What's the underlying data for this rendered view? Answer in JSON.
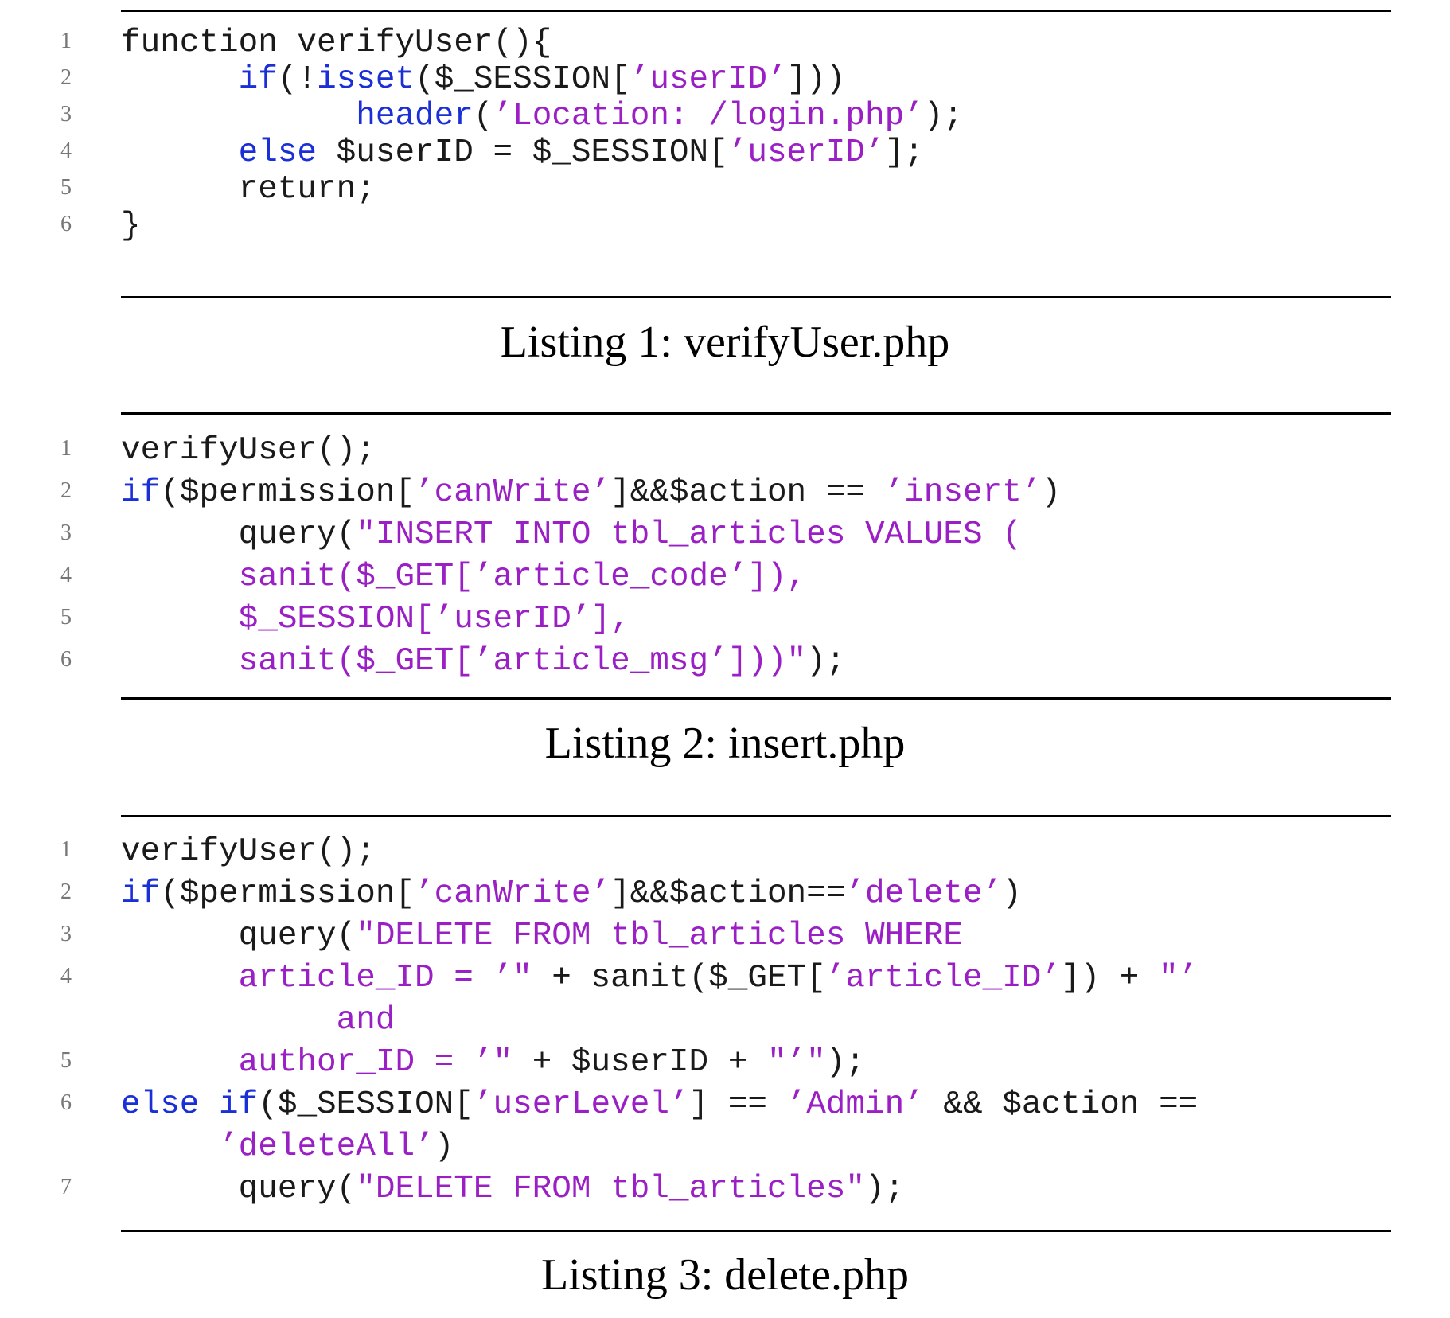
{
  "colors": {
    "keyword": "#1a2fd6",
    "string": "#9a1fc4",
    "plain": "#1a1a1a",
    "line_number": "#777777"
  },
  "listings": [
    {
      "caption": "Listing 1: verifyUser.php",
      "lines": [
        {
          "num": "1",
          "segments": [
            {
              "t": "function verifyUser(){",
              "k": "plain"
            }
          ]
        },
        {
          "num": "2",
          "segments": [
            {
              "t": "      ",
              "k": "plain"
            },
            {
              "t": "if",
              "k": "kw"
            },
            {
              "t": "(!",
              "k": "plain"
            },
            {
              "t": "isset",
              "k": "kw"
            },
            {
              "t": "($_SESSION[",
              "k": "plain"
            },
            {
              "t": "’userID’",
              "k": "str"
            },
            {
              "t": "]))",
              "k": "plain"
            }
          ]
        },
        {
          "num": "3",
          "segments": [
            {
              "t": "            ",
              "k": "plain"
            },
            {
              "t": "header",
              "k": "kw"
            },
            {
              "t": "(",
              "k": "plain"
            },
            {
              "t": "’Location: /login.php’",
              "k": "str"
            },
            {
              "t": ");",
              "k": "plain"
            }
          ]
        },
        {
          "num": "4",
          "segments": [
            {
              "t": "      ",
              "k": "plain"
            },
            {
              "t": "else",
              "k": "kw"
            },
            {
              "t": " $userID = $_SESSION[",
              "k": "plain"
            },
            {
              "t": "’userID’",
              "k": "str"
            },
            {
              "t": "];",
              "k": "plain"
            }
          ]
        },
        {
          "num": "5",
          "segments": [
            {
              "t": "      return;",
              "k": "plain"
            }
          ]
        },
        {
          "num": "6",
          "segments": [
            {
              "t": "}",
              "k": "plain"
            }
          ]
        }
      ]
    },
    {
      "caption": "Listing 2: insert.php",
      "lines": [
        {
          "num": "1",
          "segments": [
            {
              "t": "verifyUser();",
              "k": "plain"
            }
          ]
        },
        {
          "num": "2",
          "segments": [
            {
              "t": "if",
              "k": "kw"
            },
            {
              "t": "($permission[",
              "k": "plain"
            },
            {
              "t": "’canWrite’",
              "k": "str"
            },
            {
              "t": "]&&$action == ",
              "k": "plain"
            },
            {
              "t": "’insert’",
              "k": "str"
            },
            {
              "t": ")",
              "k": "plain"
            }
          ]
        },
        {
          "num": "3",
          "segments": [
            {
              "t": "      query(",
              "k": "plain"
            },
            {
              "t": "\"INSERT INTO tbl_articles VALUES (",
              "k": "str"
            }
          ]
        },
        {
          "num": "4",
          "segments": [
            {
              "t": "      ",
              "k": "plain"
            },
            {
              "t": "sanit($_GET[’article_code’]),",
              "k": "str"
            }
          ]
        },
        {
          "num": "5",
          "segments": [
            {
              "t": "      ",
              "k": "plain"
            },
            {
              "t": "$_SESSION[’userID’],",
              "k": "str"
            }
          ]
        },
        {
          "num": "6",
          "segments": [
            {
              "t": "      ",
              "k": "plain"
            },
            {
              "t": "sanit($_GET[’article_msg’]))\"",
              "k": "str"
            },
            {
              "t": ");",
              "k": "plain"
            }
          ]
        }
      ]
    },
    {
      "caption": "Listing 3: delete.php",
      "lines": [
        {
          "num": "1",
          "segments": [
            {
              "t": "verifyUser();",
              "k": "plain"
            }
          ]
        },
        {
          "num": "2",
          "segments": [
            {
              "t": "if",
              "k": "kw"
            },
            {
              "t": "($permission[",
              "k": "plain"
            },
            {
              "t": "’canWrite’",
              "k": "str"
            },
            {
              "t": "]&&$action==",
              "k": "plain"
            },
            {
              "t": "’delete’",
              "k": "str"
            },
            {
              "t": ")",
              "k": "plain"
            }
          ]
        },
        {
          "num": "3",
          "segments": [
            {
              "t": "      query(",
              "k": "plain"
            },
            {
              "t": "\"DELETE FROM tbl_articles WHERE",
              "k": "str"
            }
          ]
        },
        {
          "num": "4",
          "segments": [
            {
              "t": "      ",
              "k": "plain"
            },
            {
              "t": "article_ID = ’\"",
              "k": "str"
            },
            {
              "t": " + sanit($_GET[",
              "k": "plain"
            },
            {
              "t": "’article_ID’",
              "k": "str"
            },
            {
              "t": "]) + ",
              "k": "plain"
            },
            {
              "t": "\"’",
              "k": "str"
            }
          ]
        },
        {
          "num": "",
          "segments": [
            {
              "t": "           ",
              "k": "plain"
            },
            {
              "t": "and",
              "k": "str"
            }
          ]
        },
        {
          "num": "5",
          "segments": [
            {
              "t": "      ",
              "k": "plain"
            },
            {
              "t": "author_ID = ’\"",
              "k": "str"
            },
            {
              "t": " + $userID + ",
              "k": "plain"
            },
            {
              "t": "\"’\"",
              "k": "str"
            },
            {
              "t": ");",
              "k": "plain"
            }
          ]
        },
        {
          "num": "6",
          "segments": [
            {
              "t": "else",
              "k": "kw"
            },
            {
              "t": " ",
              "k": "plain"
            },
            {
              "t": "if",
              "k": "kw"
            },
            {
              "t": "($_SESSION[",
              "k": "plain"
            },
            {
              "t": "’userLevel’",
              "k": "str"
            },
            {
              "t": "] == ",
              "k": "plain"
            },
            {
              "t": "’Admin’",
              "k": "str"
            },
            {
              "t": " && $action ==",
              "k": "plain"
            }
          ]
        },
        {
          "num": "",
          "segments": [
            {
              "t": "     ",
              "k": "plain"
            },
            {
              "t": "’deleteAll’",
              "k": "str"
            },
            {
              "t": ")",
              "k": "plain"
            }
          ]
        },
        {
          "num": "7",
          "segments": [
            {
              "t": "      query(",
              "k": "plain"
            },
            {
              "t": "\"DELETE FROM tbl_articles\"",
              "k": "str"
            },
            {
              "t": ");",
              "k": "plain"
            }
          ]
        }
      ]
    }
  ]
}
